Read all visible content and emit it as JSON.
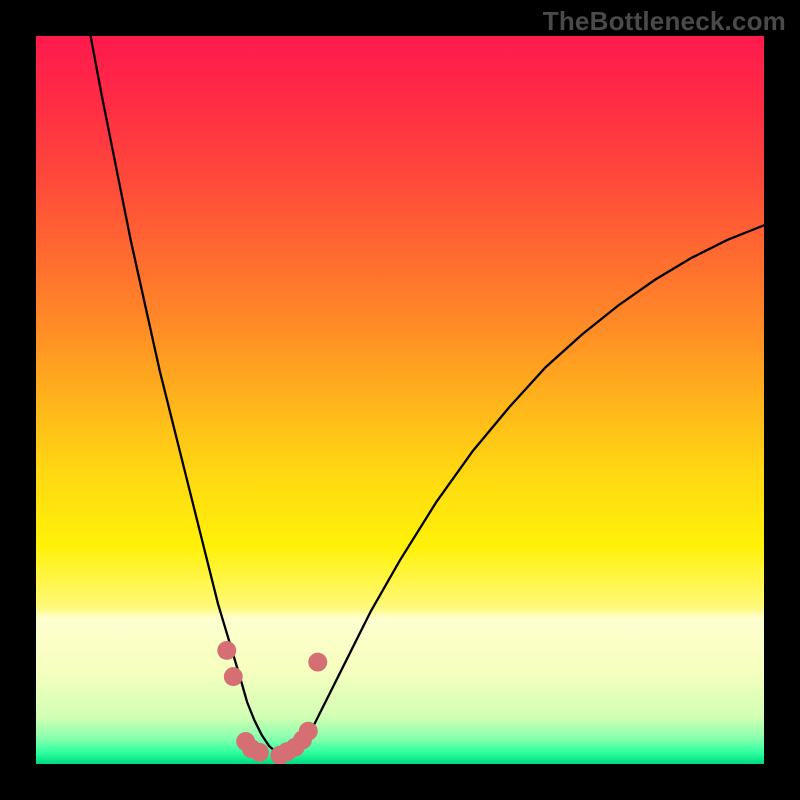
{
  "watermark": "TheBottleneck.com",
  "colors": {
    "frame": "#000000",
    "curve": "#000000",
    "marker": "#d66f74",
    "gradient_stops": [
      {
        "offset": 0.0,
        "color": "#ff1a4d"
      },
      {
        "offset": 0.1,
        "color": "#ff2e44"
      },
      {
        "offset": 0.2,
        "color": "#ff4a3a"
      },
      {
        "offset": 0.3,
        "color": "#ff6a30"
      },
      {
        "offset": 0.4,
        "color": "#ff8c26"
      },
      {
        "offset": 0.5,
        "color": "#ffb31c"
      },
      {
        "offset": 0.6,
        "color": "#ffd812"
      },
      {
        "offset": 0.7,
        "color": "#fff108"
      },
      {
        "offset": 0.785,
        "color": "#fff97a"
      },
      {
        "offset": 0.8,
        "color": "#fdffcf"
      },
      {
        "offset": 0.87,
        "color": "#f7ffbf"
      },
      {
        "offset": 0.935,
        "color": "#d2ffb4"
      },
      {
        "offset": 0.965,
        "color": "#86ffae"
      },
      {
        "offset": 0.985,
        "color": "#2cff9e"
      },
      {
        "offset": 1.0,
        "color": "#00d97e"
      }
    ]
  },
  "chart_data": {
    "type": "line",
    "title": "",
    "xlabel": "",
    "ylabel": "",
    "xlim": [
      0,
      100
    ],
    "ylim": [
      0,
      100
    ],
    "grid": false,
    "series": [
      {
        "name": "bottleneck-curve",
        "x": [
          7.5,
          9,
          11,
          13,
          15,
          17,
          19,
          21,
          23,
          25,
          26.5,
          28,
          29,
          30,
          31,
          32,
          33,
          34,
          35,
          36.5,
          38,
          40,
          43,
          46,
          50,
          55,
          60,
          65,
          70,
          75,
          80,
          85,
          90,
          95,
          100
        ],
        "y": [
          100,
          92,
          82,
          72,
          63,
          54,
          46,
          38,
          30,
          22,
          17,
          12,
          8.5,
          6,
          4,
          2.5,
          1.6,
          1.2,
          1.6,
          2.8,
          5,
          9,
          15,
          21,
          28,
          36,
          43,
          49,
          54.5,
          59,
          63,
          66.5,
          69.5,
          72,
          74
        ]
      }
    ],
    "markers": {
      "name": "highlighted-points",
      "points": [
        {
          "x": 26.2,
          "y": 15.6,
          "r": 1.3
        },
        {
          "x": 27.1,
          "y": 12.0,
          "r": 1.3
        },
        {
          "x": 28.8,
          "y": 3.1,
          "r": 1.3
        },
        {
          "x": 29.6,
          "y": 2.1,
          "r": 1.3
        },
        {
          "x": 30.7,
          "y": 1.6,
          "r": 1.3
        },
        {
          "x": 33.5,
          "y": 1.2,
          "r": 1.3
        },
        {
          "x": 34.5,
          "y": 1.7,
          "r": 1.3
        },
        {
          "x": 35.6,
          "y": 2.3,
          "r": 1.3
        },
        {
          "x": 36.6,
          "y": 3.3,
          "r": 1.3
        },
        {
          "x": 37.4,
          "y": 4.5,
          "r": 1.3
        },
        {
          "x": 38.7,
          "y": 14.0,
          "r": 1.3
        }
      ]
    }
  }
}
